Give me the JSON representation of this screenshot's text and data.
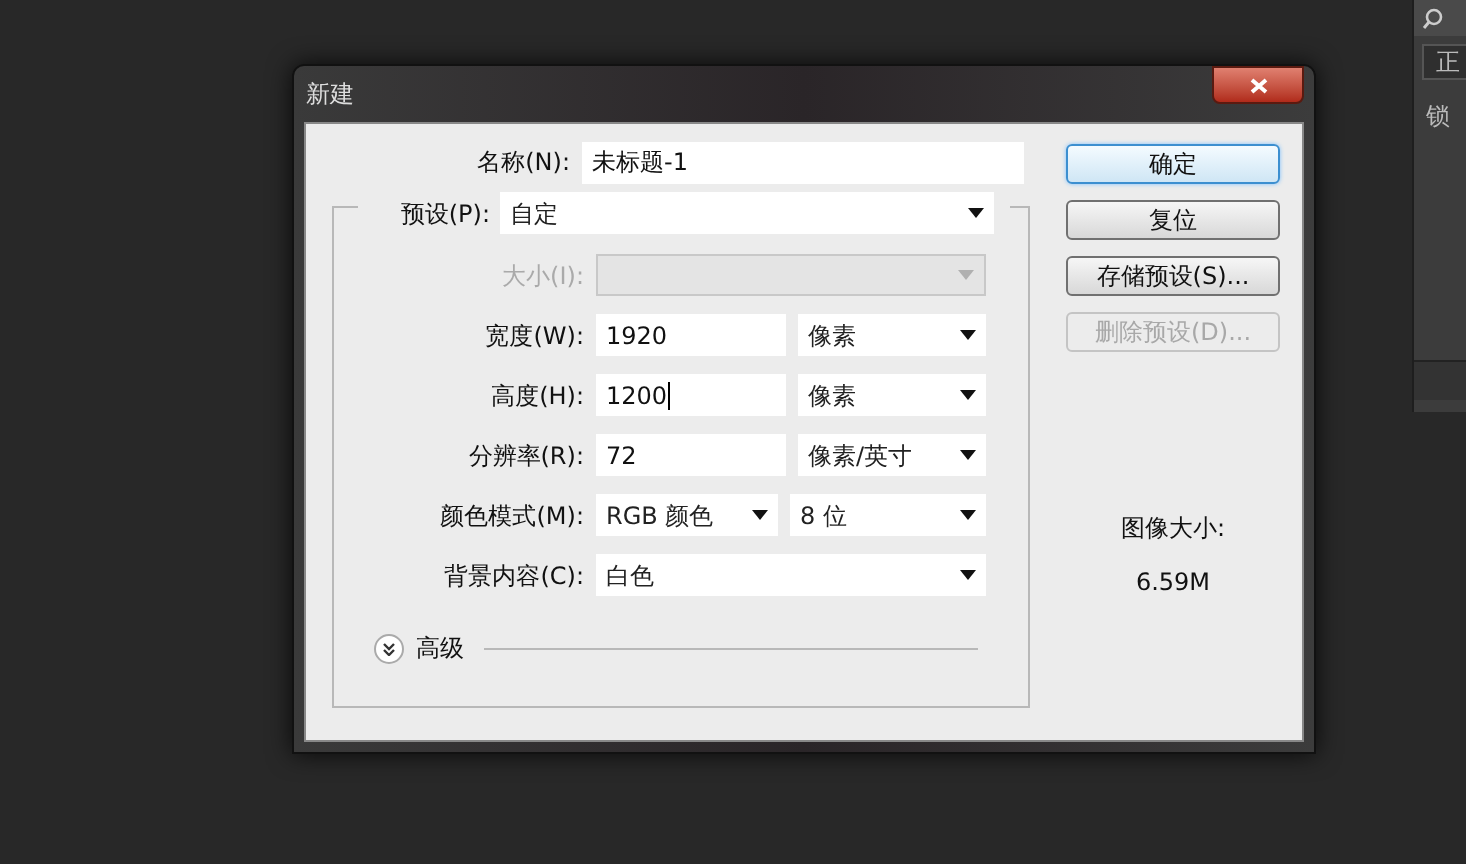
{
  "side_panel": {
    "tab": "正",
    "label": "锁"
  },
  "dialog": {
    "title": "新建",
    "name": {
      "label": "名称(N):",
      "value": "未标题-1"
    },
    "preset": {
      "label": "预设(P):",
      "value": "自定"
    },
    "rows": [
      {
        "label": "大小(I):",
        "disabled": true,
        "fields": [
          {
            "kind": "select",
            "disabled": true
          }
        ]
      },
      {
        "label": "宽度(W):",
        "disabled": false,
        "fields": [
          {
            "kind": "input",
            "value": "1920",
            "focused": false
          },
          {
            "kind": "select",
            "value": "像素",
            "disabled": false
          }
        ]
      },
      {
        "label": "高度(H):",
        "disabled": false,
        "fields": [
          {
            "kind": "input",
            "value": "1200",
            "focused": true
          },
          {
            "kind": "select",
            "value": "像素",
            "disabled": false
          }
        ]
      },
      {
        "label": "分辨率(R):",
        "disabled": false,
        "fields": [
          {
            "kind": "input",
            "value": "72",
            "focused": false
          },
          {
            "kind": "select",
            "value": "像素/英寸",
            "disabled": false
          }
        ]
      },
      {
        "label": "颜色模式(M):",
        "disabled": false,
        "fields": [
          {
            "kind": "select",
            "value": "RGB 颜色",
            "disabled": false
          },
          {
            "kind": "select",
            "value": "8 位",
            "disabled": false
          }
        ]
      },
      {
        "label": "背景内容(C):",
        "disabled": false,
        "fields": [
          {
            "kind": "select",
            "value": "白色",
            "disabled": false
          }
        ]
      }
    ],
    "advanced": {
      "label": "高级",
      "expanded": false
    },
    "buttons": [
      {
        "label": "确定",
        "default": true,
        "disabled": false
      },
      {
        "label": "复位",
        "default": false,
        "disabled": false
      },
      {
        "label": "存储预设(S)...",
        "default": false,
        "disabled": false
      },
      {
        "label": "删除预设(D)...",
        "default": false,
        "disabled": true
      }
    ],
    "image_size": {
      "label": "图像大小:",
      "value": "6.59M"
    }
  }
}
